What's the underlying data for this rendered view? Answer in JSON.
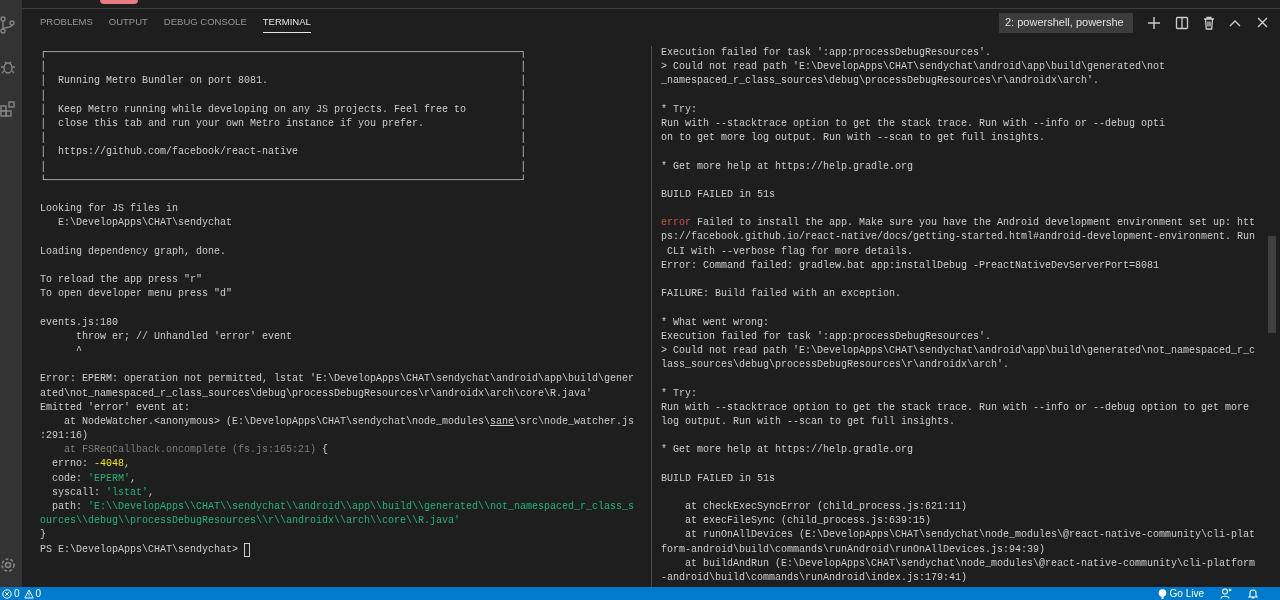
{
  "panel_tabs": [
    {
      "label": "PROBLEMS",
      "selected": false
    },
    {
      "label": "OUTPUT",
      "selected": false
    },
    {
      "label": "DEBUG CONSOLE",
      "selected": false
    },
    {
      "label": "TERMINAL",
      "selected": true
    }
  ],
  "terminal_selector": {
    "value": "2: powershell, powershe"
  },
  "terminal_panes": [
    {
      "blocks": [
        [
          "┌───────────────────────────────────────────────────────────────────────────────┐",
          "│                                                                               │",
          "│  Running Metro Bundler on port 8081.                                          │",
          "│                                                                               │",
          "│  Keep Metro running while developing on any JS projects. Feel free to         │",
          "│  close this tab and run your own Metro instance if you prefer.                │",
          "│                                                                               │",
          "│  https://github.com/facebook/react-native                                     │",
          "│                                                                               │",
          "└───────────────────────────────────────────────────────────────────────────────┘"
        ],
        [
          "Looking for JS files in",
          "   E:\\DevelopApps\\CHAT\\sendychat"
        ],
        [
          "Loading dependency graph, done."
        ],
        [
          "To reload the app press \"r\"",
          "To open developer menu press \"d\""
        ],
        [
          "events.js:180",
          "      throw er; // Unhandled 'error' event",
          "      ^"
        ],
        [
          "Error: EPERM: operation not permitted, lstat 'E:\\DevelopApps\\CHAT\\sendychat\\android\\app\\build\\gener",
          "ated\\not_namespaced_r_class_sources\\debug\\processDebugResources\\r\\androidx\\arch\\core\\R.java'",
          "Emitted 'error' event at:",
          {
            "parts": [
              {
                "kind": "plain",
                "text": "    at NodeWatcher.<anonymous> (E:\\DevelopApps\\CHAT\\sendychat\\node_modules\\"
              },
              {
                "kind": "underline",
                "text": "sane"
              },
              {
                "kind": "plain",
                "text": "\\src\\node_watcher.js"
              }
            ]
          },
          ":291:16)",
          {
            "parts": [
              {
                "kind": "dim",
                "text": "    at FSReqCallback.oncomplete (fs.js:165:21)"
              },
              {
                "kind": "plain",
                "text": " {"
              }
            ]
          },
          {
            "parts": [
              {
                "kind": "plain",
                "text": "  errno: "
              },
              {
                "kind": "number",
                "text": "-4048"
              },
              {
                "kind": "plain",
                "text": ","
              }
            ]
          },
          {
            "parts": [
              {
                "kind": "plain",
                "text": "  code: "
              },
              {
                "kind": "string",
                "text": "'EPERM'"
              },
              {
                "kind": "plain",
                "text": ","
              }
            ]
          },
          {
            "parts": [
              {
                "kind": "plain",
                "text": "  syscall: "
              },
              {
                "kind": "string",
                "text": "'lstat'"
              },
              {
                "kind": "plain",
                "text": ","
              }
            ]
          },
          {
            "parts": [
              {
                "kind": "plain",
                "text": "  path: "
              },
              {
                "kind": "string",
                "text": "'E:\\\\DevelopApps\\\\CHAT\\\\sendychat\\\\android\\\\app\\\\build\\\\generated\\\\not_namespaced_r_class_s"
              }
            ]
          },
          {
            "parts": [
              {
                "kind": "string",
                "text": "ources\\\\debug\\\\processDebugResources\\\\r\\\\androidx\\\\arch\\\\core\\\\R.java'"
              }
            ]
          },
          "}",
          {
            "parts": [
              {
                "kind": "plain",
                "text": "PS E:\\DevelopApps\\CHAT\\sendychat> "
              }
            ],
            "cursor": true
          }
        ]
      ]
    },
    {
      "blocks": [
        [
          "Execution failed for task ':app:processDebugResources'.",
          "> Could not read path 'E:\\DevelopApps\\CHAT\\sendychat\\android\\app\\build\\generated\\not",
          "_namespaced_r_class_sources\\debug\\processDebugResources\\r\\androidx\\arch'."
        ],
        [
          "* Try:",
          "Run with --stacktrace option to get the stack trace. Run with --info or --debug opti",
          "on to get more log output. Run with --scan to get full insights."
        ],
        [
          "* Get more help at https://help.gradle.org"
        ],
        [
          "BUILD FAILED in 51s"
        ],
        [
          {
            "parts": [
              {
                "kind": "error",
                "text": "error"
              },
              {
                "kind": "plain",
                "text": " Failed to install the app. Make sure you have the Android development environment set up: htt"
              }
            ]
          },
          "ps://facebook.github.io/react-native/docs/getting-started.html#android-development-environment. Run",
          " CLI with --verbose flag for more details.",
          "Error: Command failed: gradlew.bat app:installDebug -PreactNativeDevServerPort=8081"
        ],
        [
          "FAILURE: Build failed with an exception."
        ],
        [
          "* What went wrong:",
          "Execution failed for task ':app:processDebugResources'.",
          "> Could not read path 'E:\\DevelopApps\\CHAT\\sendychat\\android\\app\\build\\generated\\not_namespaced_r_c",
          "lass_sources\\debug\\processDebugResources\\r\\androidx\\arch'."
        ],
        [
          "* Try:",
          "Run with --stacktrace option to get the stack trace. Run with --info or --debug option to get more",
          "log output. Run with --scan to get full insights."
        ],
        [
          "* Get more help at https://help.gradle.org"
        ],
        [
          "BUILD FAILED in 51s"
        ],
        [
          "    at checkExecSyncError (child_process.js:621:11)",
          "    at execFileSync (child_process.js:639:15)",
          "    at runOnAllDevices (E:\\DevelopApps\\CHAT\\sendychat\\node_modules\\@react-native-community\\cli-plat",
          "form-android\\build\\commands\\runAndroid\\runOnAllDevices.js:94:39)",
          "    at buildAndRun (E:\\DevelopApps\\CHAT\\sendychat\\node_modules\\@react-native-community\\cli-platform",
          "-android\\build\\commands\\runAndroid\\index.js:179:41)"
        ]
      ]
    }
  ],
  "status_bar": {
    "errors": "0",
    "warnings": "0",
    "go_live": "Go Live"
  }
}
